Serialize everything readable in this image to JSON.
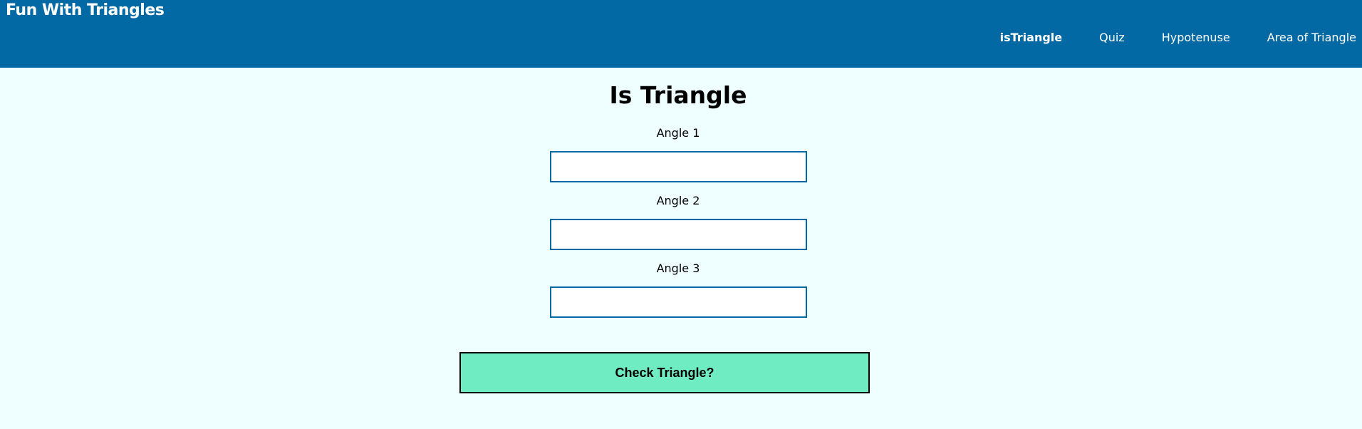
{
  "header": {
    "brand": "Fun With Triangles",
    "nav": [
      {
        "label": "isTriangle",
        "active": true
      },
      {
        "label": "Quiz",
        "active": false
      },
      {
        "label": "Hypotenuse",
        "active": false
      },
      {
        "label": "Area of Triangle",
        "active": false
      }
    ]
  },
  "main": {
    "title": "Is Triangle",
    "fields": [
      {
        "label": "Angle 1",
        "value": "",
        "placeholder": ""
      },
      {
        "label": "Angle 2",
        "value": "",
        "placeholder": ""
      },
      {
        "label": "Angle 3",
        "value": "",
        "placeholder": ""
      }
    ],
    "submit_label": "Check Triangle?"
  },
  "colors": {
    "header_bg": "#0269a4",
    "page_bg": "#efffff",
    "input_border": "#0269a4",
    "button_bg": "#70ecc3"
  }
}
